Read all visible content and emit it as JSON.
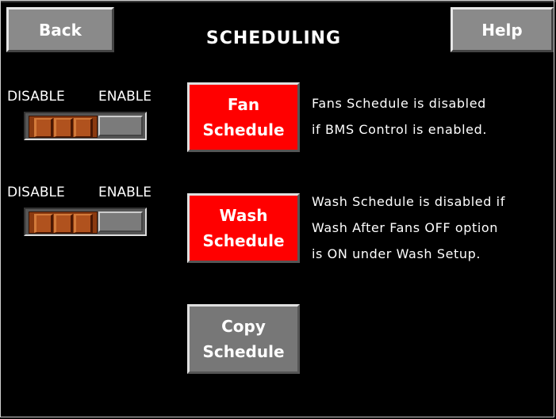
{
  "header": {
    "title": "SCHEDULING",
    "back_label": "Back",
    "help_label": "Help"
  },
  "fan": {
    "disable_label": "DISABLE",
    "enable_label": "ENABLE",
    "toggle_state": "disabled",
    "button_line1": "Fan",
    "button_line2": "Schedule",
    "info_lines": [
      "Fans Schedule is disabled",
      "if BMS Control is enabled."
    ]
  },
  "wash": {
    "disable_label": "DISABLE",
    "enable_label": "ENABLE",
    "toggle_state": "disabled",
    "button_line1": "Wash",
    "button_line2": "Schedule",
    "info_lines": [
      "Wash Schedule is disabled if",
      "Wash After Fans OFF option",
      "is ON under Wash Setup."
    ]
  },
  "copy": {
    "button_line1": "Copy",
    "button_line2": "Schedule"
  },
  "colors": {
    "background": "#000000",
    "active_button": "#ff0000",
    "neutral_button": "#777777",
    "toggle_knob": "#8b3a10"
  }
}
